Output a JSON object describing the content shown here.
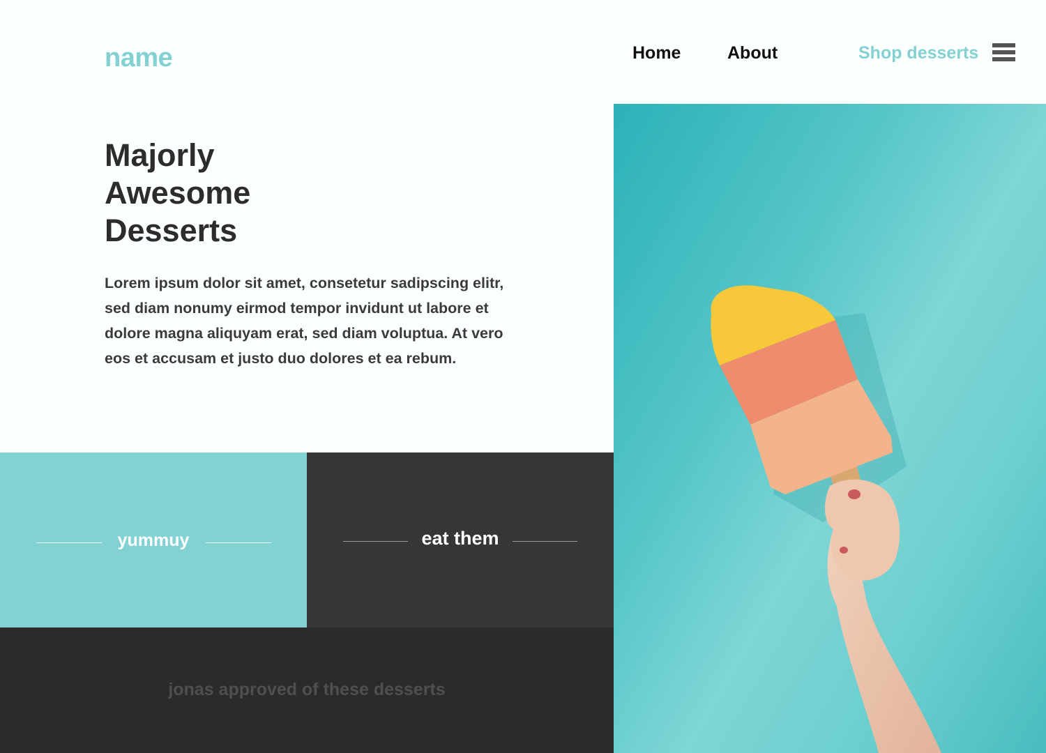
{
  "brand": {
    "logo": "name",
    "accent_color": "#83d1d2"
  },
  "nav": {
    "items": [
      {
        "label": "Home"
      },
      {
        "label": "About"
      },
      {
        "label": "Shop desserts",
        "highlight": true
      }
    ],
    "menu_icon": "hamburger-menu-icon"
  },
  "hero": {
    "title_lines": [
      "Majorly",
      "Awesome",
      "Desserts"
    ],
    "body": "Lorem ipsum dolor sit amet, consetetur sadipscing elitr, sed diam nonumy eirmod tempor invidunt ut labore et dolore magna aliquyam erat, sed diam voluptua. At vero eos et accusam et justo duo dolores et ea rebum."
  },
  "tiles": [
    {
      "label": "yummuy",
      "background": "#83d2d3"
    },
    {
      "label": "eat them",
      "background": "#363636"
    }
  ],
  "footer": {
    "text": "jonas approved of these desserts",
    "background": "#2b2b2b"
  },
  "photo": {
    "subject": "hand-holding-sponge-popsicle",
    "background": "#5ec8ca"
  }
}
